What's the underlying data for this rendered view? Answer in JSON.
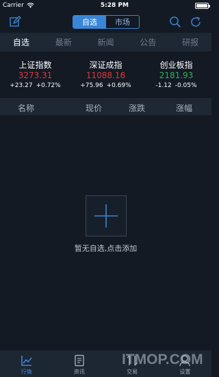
{
  "status_bar": {
    "carrier": "Carrier",
    "time": "5:28 PM",
    "battery_level": 1.0
  },
  "nav": {
    "segments": [
      "自选",
      "市场"
    ],
    "active_segment": 0
  },
  "tabs": [
    {
      "label": "自选",
      "active": true
    },
    {
      "label": "最新",
      "active": false
    },
    {
      "label": "新闻",
      "active": false
    },
    {
      "label": "公告",
      "active": false
    },
    {
      "label": "研报",
      "active": false
    }
  ],
  "indices": [
    {
      "name": "上证指数",
      "price": "3273.31",
      "change": "+23.27",
      "percent": "+0.72%",
      "trend": "up"
    },
    {
      "name": "深证成指",
      "price": "11088.16",
      "change": "+75.96",
      "percent": "+0.69%",
      "trend": "up"
    },
    {
      "name": "创业板指",
      "price": "2181.93",
      "change": "-1.12",
      "percent": "-0.05%",
      "trend": "down"
    }
  ],
  "columns": [
    "名称",
    "现价",
    "涨跌",
    "涨幅"
  ],
  "empty": {
    "text": "暂无自选,点击添加"
  },
  "tab_bar": [
    {
      "label": "行情",
      "icon": "chart-icon",
      "active": true
    },
    {
      "label": "资讯",
      "icon": "news-icon",
      "active": false
    },
    {
      "label": "交易",
      "icon": "trade-icon",
      "active": false
    },
    {
      "label": "设置",
      "icon": "settings-icon",
      "active": false
    }
  ],
  "watermark": "ITMOP.COM",
  "colors": {
    "background": "#131a24",
    "accent": "#3a86d6",
    "up": "#e0353b",
    "down": "#2fb05a"
  }
}
